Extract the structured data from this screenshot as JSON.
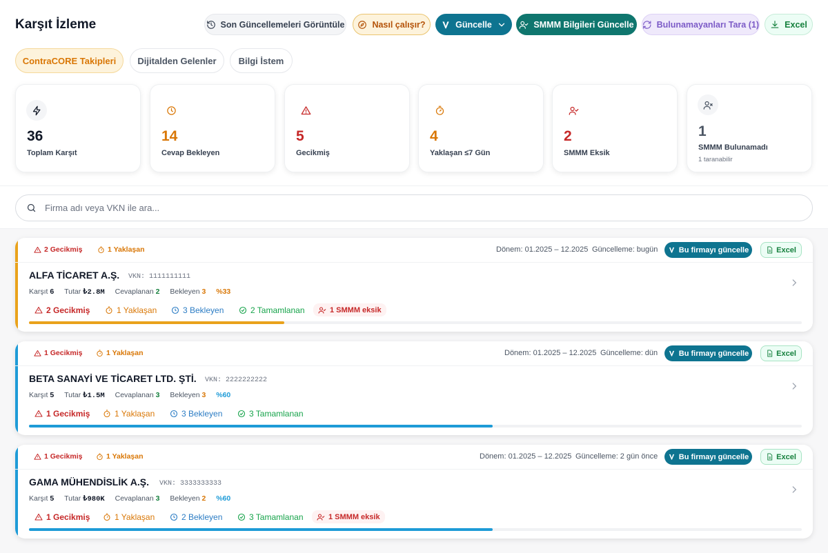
{
  "header": {
    "title": "Karşıt İzleme",
    "buttons": {
      "recent": "Son Güncellemeleri Görüntüle",
      "howto": "Nasıl çalışır?",
      "update": "Güncelle",
      "smmm": "SMMM Bilgileri Güncelle",
      "scan": "Bulunamayanları Tara (1)",
      "excel": "Excel"
    }
  },
  "tabs": [
    "ContraCORE Takipleri",
    "Dijitalden Gelenler",
    "Bilgi İstem"
  ],
  "stats": [
    {
      "value": "36",
      "label": "Toplam Karşıt",
      "icon": "bolt-icon",
      "color": "#111827"
    },
    {
      "value": "14",
      "label": "Cevap Bekleyen",
      "icon": "clock-icon",
      "color": "#d97706"
    },
    {
      "value": "5",
      "label": "Gecikmiş",
      "icon": "warning-icon",
      "color": "#c62828"
    },
    {
      "value": "4",
      "label": "Yaklaşan ≤7 Gün",
      "icon": "timer-icon",
      "color": "#d97706"
    },
    {
      "value": "2",
      "label": "SMMM Eksik",
      "icon": "user-check-icon",
      "color": "#c62828"
    },
    {
      "value": "1",
      "label": "SMMM Bulunamadı",
      "sub": "1 taranabilir",
      "icon": "user-x-icon",
      "color": "#4b5563"
    }
  ],
  "search": {
    "placeholder": "Firma adı veya VKN ile ara..."
  },
  "cards": [
    {
      "accent": "#e9a21b",
      "chips": [
        "2 Gecikmiş",
        "1 Yaklaşan"
      ],
      "period": "Dönem: 01.2025 – 12.2025",
      "updated": "Güncelleme: bugün",
      "update_btn": "Bu firmayı güncelle",
      "excel_btn": "Excel",
      "name": "ALFA TİCARET A.Ş.",
      "vkn": "VKN: 1111111111",
      "karsit_label": "Karşıt",
      "karsit": "6",
      "tutar_label": "Tutar",
      "tutar": "₺2.8M",
      "cevaplanan_label": "Cevaplanan",
      "cevaplanan": "2",
      "bekleyen_label": "Bekleyen",
      "bekleyen": "3",
      "pct": "%33",
      "pct_color": "#d97706",
      "pills": [
        "2 Gecikmiş",
        "1 Yaklaşan",
        "3 Bekleyen",
        "2 Tamamlanan"
      ],
      "smmm": "1 SMMM eksik",
      "progress": 0.33
    },
    {
      "accent": "#1e9bd7",
      "chips": [
        "1 Gecikmiş",
        "1 Yaklaşan"
      ],
      "period": "Dönem: 01.2025 – 12.2025",
      "updated": "Güncelleme: dün",
      "update_btn": "Bu firmayı güncelle",
      "excel_btn": "Excel",
      "name": "BETA SANAYİ VE TİCARET LTD. ŞTİ.",
      "vkn": "VKN: 2222222222",
      "karsit_label": "Karşıt",
      "karsit": "5",
      "tutar_label": "Tutar",
      "tutar": "₺1.5M",
      "cevaplanan_label": "Cevaplanan",
      "cevaplanan": "3",
      "bekleyen_label": "Bekleyen",
      "bekleyen": "3",
      "pct": "%60",
      "pct_color": "#1e9bd7",
      "pills": [
        "1 Gecikmiş",
        "1 Yaklaşan",
        "3 Bekleyen",
        "3 Tamamlanan"
      ],
      "smmm": "",
      "progress": 0.6
    },
    {
      "accent": "#1e9bd7",
      "chips": [
        "1 Gecikmiş",
        "1 Yaklaşan"
      ],
      "period": "Dönem: 01.2025 – 12.2025",
      "updated": "Güncelleme: 2 gün önce",
      "update_btn": "Bu firmayı güncelle",
      "excel_btn": "Excel",
      "name": "GAMA MÜHENDİSLİK A.Ş.",
      "vkn": "VKN: 3333333333",
      "karsit_label": "Karşıt",
      "karsit": "5",
      "tutar_label": "Tutar",
      "tutar": "₺980K",
      "cevaplanan_label": "Cevaplanan",
      "cevaplanan": "3",
      "bekleyen_label": "Bekleyen",
      "bekleyen": "2",
      "pct": "%60",
      "pct_color": "#1e9bd7",
      "pills": [
        "1 Gecikmiş",
        "1 Yaklaşan",
        "2 Bekleyen",
        "3 Tamamlanan"
      ],
      "smmm": "1 SMMM eksik",
      "progress": 0.6
    }
  ]
}
